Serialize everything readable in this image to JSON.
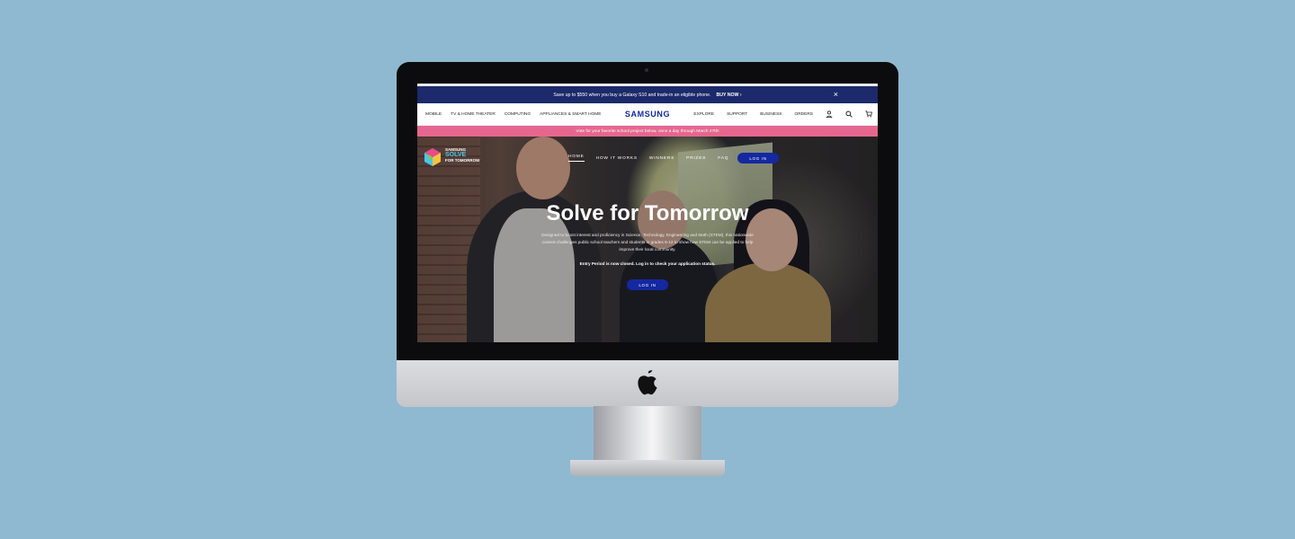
{
  "promo": {
    "text": "Save up to $550 when you buy a Galaxy S10 and trade-in an eligible phone.",
    "cta": "BUY NOW ›",
    "close": "×"
  },
  "global_nav": {
    "left_items": [
      "MOBILE",
      "TV & HOME THEATER",
      "COMPUTING",
      "APPLIANCES & SMART HOME"
    ],
    "brand": "SAMSUNG",
    "right_items": [
      "EXPLORE",
      "SUPPORT",
      "BUSINESS",
      "ORDERS"
    ],
    "icons": [
      "account-icon",
      "search-icon",
      "cart-icon"
    ]
  },
  "vote_bar": {
    "text": "Vote for your favorite school project below, once a day through March 27th!"
  },
  "hero": {
    "logo": {
      "line1": "SAMSUNG",
      "line2": "SOLVE",
      "line3": "FOR TOMORROW"
    },
    "nav": [
      "HOME",
      "HOW IT WORKS",
      "WINNERS",
      "PRIZES",
      "FAQ"
    ],
    "active_nav": "HOME",
    "nav_login": "LOG IN",
    "title": "Solve for Tomorrow",
    "description": "Designed to boost interest and proficiency in Science, Technology, Engineering and Math (STEM), this nationwide contest challenges public school teachers and students in grades 6-12 to show how STEM can be applied to help improve their local community.",
    "note": "Entry Period is now closed. Log in to check your application status.",
    "login": "LOG IN"
  },
  "colors": {
    "background": "#8fb9d1",
    "promo_bar": "#1c2a6b",
    "vote_bar": "#e5678f",
    "samsung_blue": "#1428a0"
  }
}
